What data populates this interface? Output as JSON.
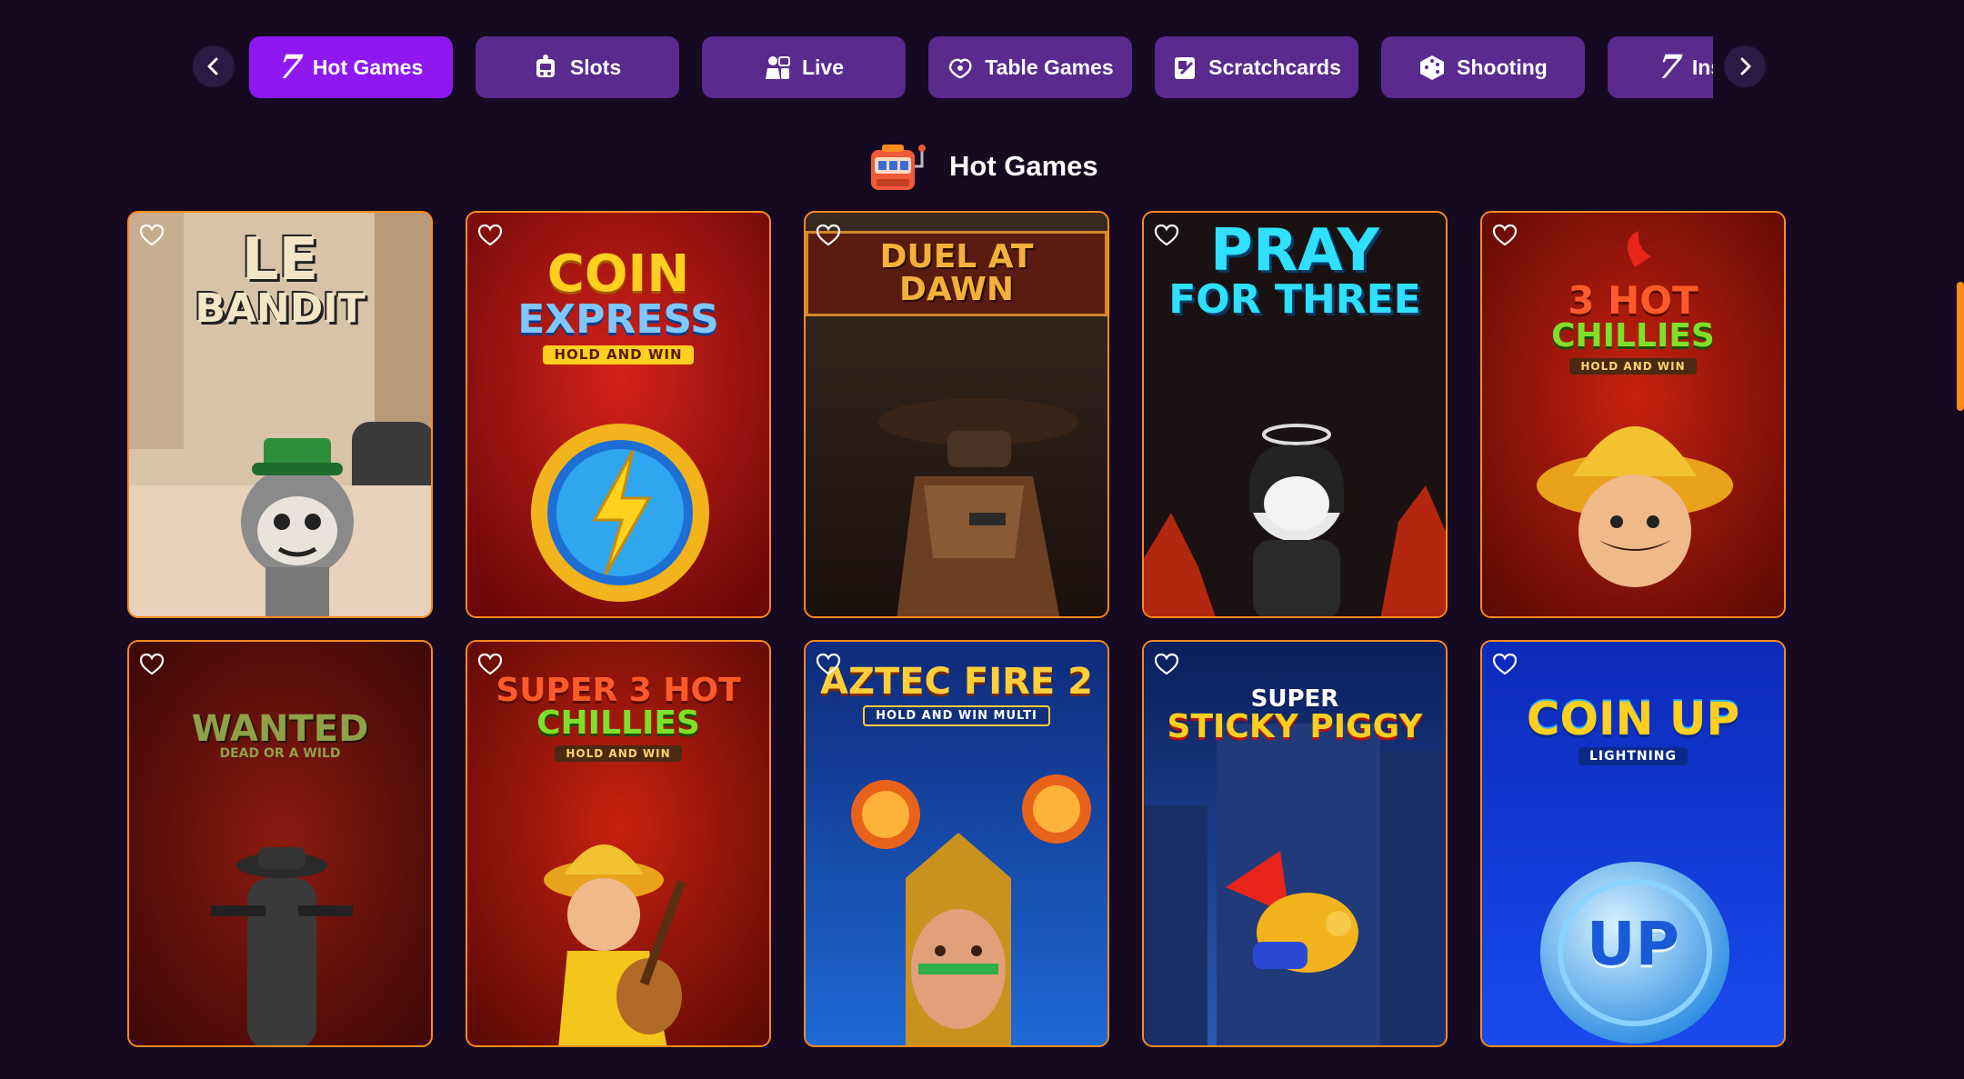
{
  "nav": {
    "tabs": [
      {
        "label": "Hot Games",
        "icon": "seven-icon",
        "active": true
      },
      {
        "label": "Slots",
        "icon": "slot-machine-icon",
        "active": false
      },
      {
        "label": "Live",
        "icon": "live-dealer-icon",
        "active": false
      },
      {
        "label": "Table Games",
        "icon": "cards-icon",
        "active": false
      },
      {
        "label": "Scratchcards",
        "icon": "scratchcard-icon",
        "active": false
      },
      {
        "label": "Shooting",
        "icon": "dice-icon",
        "active": false
      },
      {
        "label": "Instant",
        "icon": "seven-icon",
        "active": false
      }
    ]
  },
  "section": {
    "title": "Hot Games",
    "icon": "slot-machine-icon"
  },
  "games": [
    {
      "logo_line1": "LE",
      "logo_line2": "BANDIT",
      "sub": ""
    },
    {
      "logo_line1": "COIN",
      "logo_line2": "EXPRESS",
      "sub": "HOLD AND WIN"
    },
    {
      "logo_line1": "DUEL AT DAWN",
      "logo_line2": "",
      "sub": ""
    },
    {
      "logo_line1": "PRAY",
      "logo_line2": "FOR THREE",
      "sub": ""
    },
    {
      "logo_line1": "3 HOT",
      "logo_line2": "CHILLIES",
      "sub": "HOLD AND WIN"
    },
    {
      "logo_line1": "WANTED",
      "logo_line2": "DEAD OR A WILD",
      "sub": ""
    },
    {
      "logo_line1": "SUPER 3 HOT",
      "logo_line2": "CHILLIES",
      "sub": "HOLD AND WIN"
    },
    {
      "logo_line1": "AZTEC FIRE 2",
      "logo_line2": "",
      "sub": "HOLD AND WIN MULTI"
    },
    {
      "logo_line1": "SUPER",
      "logo_line2": "STICKY PIGGY",
      "sub": ""
    },
    {
      "logo_line1": "COIN UP",
      "logo_line2": "",
      "sub": "LIGHTNING",
      "coin_text": "UP"
    }
  ],
  "colors": {
    "background": "#150a22",
    "tab": "#5a2a8f",
    "tab_active": "#8d18f2",
    "card_border": "#ff8a1e",
    "scrollbar": "#ff8a1e"
  }
}
